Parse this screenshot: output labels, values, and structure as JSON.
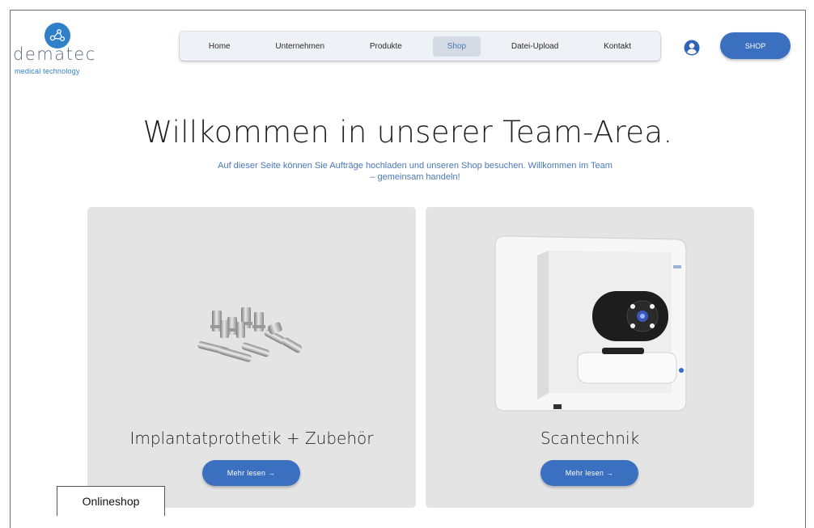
{
  "brand": {
    "name": "dematec",
    "tagline": "medical technology"
  },
  "nav": {
    "items": [
      {
        "label": "Home",
        "active": false
      },
      {
        "label": "Unternehmen",
        "active": false
      },
      {
        "label": "Produkte",
        "active": false
      },
      {
        "label": "Shop",
        "active": true
      },
      {
        "label": "Datei-Upload",
        "active": false
      },
      {
        "label": "Kontakt",
        "active": false
      }
    ],
    "user_icon": "user-circle-icon",
    "shop_button": "SHOP"
  },
  "hero": {
    "title": "Willkommen in unserer Team-Area.",
    "subtitle_line1": "Auf dieser Seite können Sie Aufträge hochladen und unseren Shop besuchen. Willkommen im Team",
    "subtitle_line2": "– gemeinsam handeln!"
  },
  "cards": [
    {
      "title": "Implantatprothetik + Zubehör",
      "button": "Mehr lesen →",
      "image": "implant-components-image"
    },
    {
      "title": "Scantechnik",
      "button": "Mehr lesen →",
      "image": "dental-scanner-image"
    }
  ],
  "caption": "Onlineshop",
  "colors": {
    "accent": "#3b6fc0",
    "accent_text": "#4a78b8",
    "card_bg": "#e4e4e4",
    "nav_bg": "#eef1f5"
  }
}
